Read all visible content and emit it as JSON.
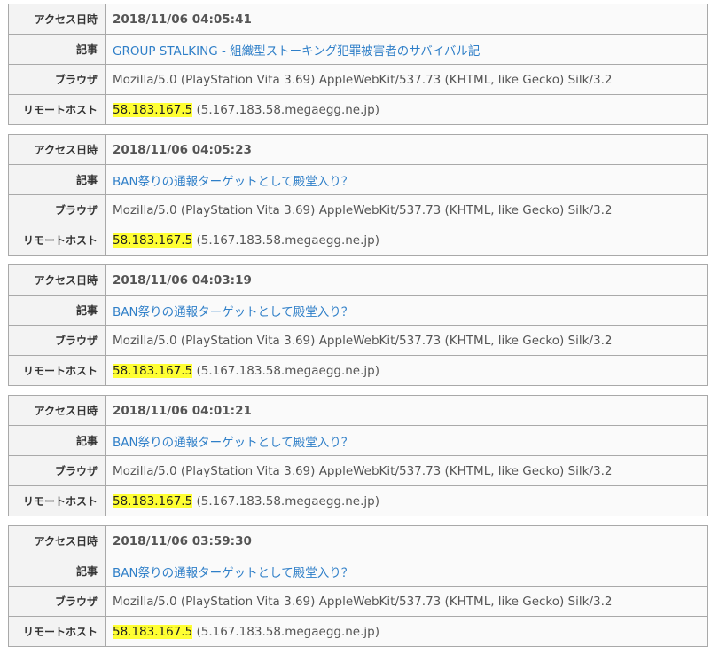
{
  "labels": {
    "access_time": "アクセス日時",
    "article": "記事",
    "browser": "ブラウザ",
    "remote_host": "リモートホスト"
  },
  "entries": [
    {
      "datetime": "2018/11/06 04:05:41",
      "article": "GROUP STALKING - 組織型ストーキング犯罪被害者のサバイバル記",
      "browser": "Mozilla/5.0 (PlayStation Vita 3.69) AppleWebKit/537.73 (KHTML, like Gecko) Silk/3.2",
      "ip": "58.183.167.5",
      "hostname": " (5.167.183.58.megaegg.ne.jp)"
    },
    {
      "datetime": "2018/11/06 04:05:23",
      "article": "BAN祭りの通報ターゲットとして殿堂入り？",
      "browser": "Mozilla/5.0 (PlayStation Vita 3.69) AppleWebKit/537.73 (KHTML, like Gecko) Silk/3.2",
      "ip": "58.183.167.5",
      "hostname": " (5.167.183.58.megaegg.ne.jp)"
    },
    {
      "datetime": "2018/11/06 04:03:19",
      "article": "BAN祭りの通報ターゲットとして殿堂入り？",
      "browser": "Mozilla/5.0 (PlayStation Vita 3.69) AppleWebKit/537.73 (KHTML, like Gecko) Silk/3.2",
      "ip": "58.183.167.5",
      "hostname": " (5.167.183.58.megaegg.ne.jp)"
    },
    {
      "datetime": "2018/11/06 04:01:21",
      "article": "BAN祭りの通報ターゲットとして殿堂入り？",
      "browser": "Mozilla/5.0 (PlayStation Vita 3.69) AppleWebKit/537.73 (KHTML, like Gecko) Silk/3.2",
      "ip": "58.183.167.5",
      "hostname": " (5.167.183.58.megaegg.ne.jp)"
    },
    {
      "datetime": "2018/11/06 03:59:30",
      "article": "BAN祭りの通報ターゲットとして殿堂入り？",
      "browser": "Mozilla/5.0 (PlayStation Vita 3.69) AppleWebKit/537.73 (KHTML, like Gecko) Silk/3.2",
      "ip": "58.183.167.5",
      "hostname": " (5.167.183.58.megaegg.ne.jp)"
    }
  ],
  "colors": {
    "link": "#2f7fc8",
    "ip_highlight": "#ffff33",
    "border": "#a9a9a9",
    "header_bg": "#f3f3f3"
  }
}
